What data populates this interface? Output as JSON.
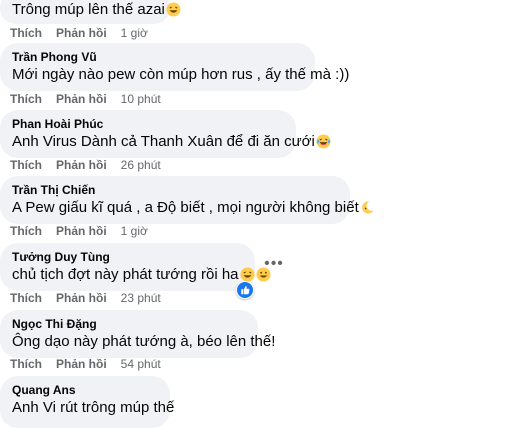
{
  "actions": {
    "like": "Thích",
    "reply": "Phản hồi"
  },
  "comments": [
    {
      "author": "",
      "text": "Trông múp lên thế azai",
      "emoji": "laughing-emoji",
      "time": "1 giờ"
    },
    {
      "author": "Trần Phong Vũ",
      "text": "Mới ngày nào pew còn múp hơn rus , ấy thế mà :))",
      "time": "10 phút"
    },
    {
      "author": "Phan Hoài Phúc",
      "text": "Anh Virus Dành cả Thanh Xuân để đi ăn cưới",
      "emoji": "laughing-tears-emoji",
      "time": "26 phút"
    },
    {
      "author": "Trần Thị Chiến",
      "text": "A Pew giấu kĩ quá , a Độ biết , mọi người không biết",
      "emoji": "crescent-moon-emoji",
      "time": "1 giờ"
    },
    {
      "author": "Tưởng Duy Tùng",
      "text": "chủ tịch đợt này phát tướng rồi ha",
      "emoji": "grinning-emoji",
      "time": "23 phút",
      "reaction": "like-reaction-icon"
    },
    {
      "author": "Ngọc Thi Đặng",
      "text": "Ông dạo này phát tướng à, béo lên thế!",
      "time": "54 phút"
    },
    {
      "author": "Quang Ans",
      "text": "Anh Vi rút trông múp thế"
    }
  ],
  "colors": {
    "bubble": "#f0f2f5",
    "secondary_text": "#65676b",
    "like_blue": "#1877f2",
    "emoji_yellow": "#ffcc4d"
  }
}
